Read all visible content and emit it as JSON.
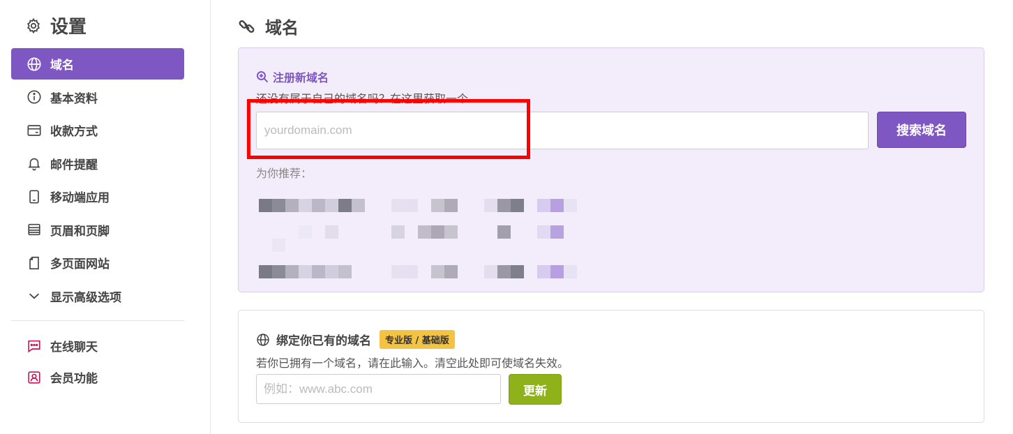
{
  "sidebar": {
    "title": "设置",
    "items": [
      {
        "label": "域名",
        "icon": "globe-icon",
        "active": true
      },
      {
        "label": "基本资料",
        "icon": "info-icon"
      },
      {
        "label": "收款方式",
        "icon": "card-icon"
      },
      {
        "label": "邮件提醒",
        "icon": "bell-icon"
      },
      {
        "label": "移动端应用",
        "icon": "mobile-icon"
      },
      {
        "label": "页眉和页脚",
        "icon": "header-footer-icon"
      },
      {
        "label": "多页面网站",
        "icon": "page-icon"
      },
      {
        "label": "显示高级选项",
        "icon": "chevron-down-icon"
      }
    ],
    "extra_items": [
      {
        "label": "在线聊天",
        "icon": "chat-icon"
      },
      {
        "label": "会员功能",
        "icon": "member-icon"
      }
    ]
  },
  "main": {
    "title": "域名",
    "register": {
      "title": "注册新域名",
      "subtitle": "还没有属于自己的域名吗？在这里获取一个",
      "placeholder": "yourdomain.com",
      "search_label": "搜索域名",
      "recommend_label": "为你推荐："
    },
    "bind": {
      "title": "绑定你已有的域名",
      "badge": "专业版 / 基础版",
      "subtitle": "若你已拥有一个域名，请在此输入。清空此处即可使域名失效。",
      "placeholder": "例如：www.abc.com",
      "update_label": "更新"
    }
  },
  "colors": {
    "accent": "#7e57c2",
    "highlight": "#ff0000",
    "update": "#8fb21b",
    "badge": "#f5c342",
    "chat_icon": "#c2185b"
  }
}
